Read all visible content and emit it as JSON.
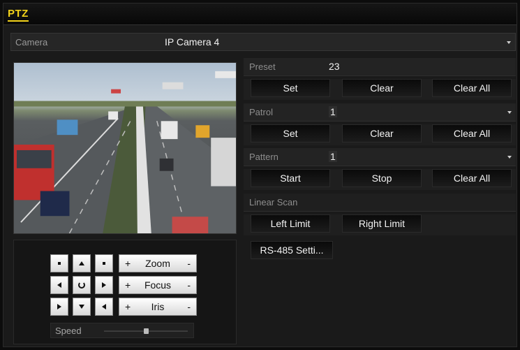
{
  "window": {
    "title": "PTZ"
  },
  "camera": {
    "label": "Camera",
    "value": "IP Camera 4"
  },
  "preset": {
    "label": "Preset",
    "value": "23",
    "buttons": {
      "set": "Set",
      "clear": "Clear",
      "clear_all": "Clear All"
    }
  },
  "patrol": {
    "label": "Patrol",
    "value": "1",
    "buttons": {
      "set": "Set",
      "clear": "Clear",
      "clear_all": "Clear All"
    }
  },
  "pattern": {
    "label": "Pattern",
    "value": "1",
    "buttons": {
      "start": "Start",
      "stop": "Stop",
      "clear_all": "Clear All"
    }
  },
  "linear_scan": {
    "label": "Linear Scan",
    "buttons": {
      "left_limit": "Left Limit",
      "right_limit": "Right Limit"
    }
  },
  "rs485": {
    "label": "RS-485 Setti..."
  },
  "controls": {
    "zoom": {
      "plus": "+",
      "label": "Zoom",
      "minus": "-"
    },
    "focus": {
      "plus": "+",
      "label": "Focus",
      "minus": "-"
    },
    "iris": {
      "plus": "+",
      "label": "Iris",
      "minus": "-"
    },
    "speed": {
      "label": "Speed",
      "level_fraction": 0.5
    }
  },
  "icons": {
    "direction_pad": [
      "arrow-up-left",
      "arrow-up",
      "arrow-up-right",
      "arrow-left",
      "auto-rotate",
      "arrow-right",
      "arrow-down-left",
      "arrow-down",
      "arrow-down-right"
    ],
    "dropdown": "chevron-down-icon"
  },
  "colors": {
    "title_accent": "#f2d21a",
    "panel_bg": "#1a1a1a",
    "button_light": "#f3f3f3"
  }
}
